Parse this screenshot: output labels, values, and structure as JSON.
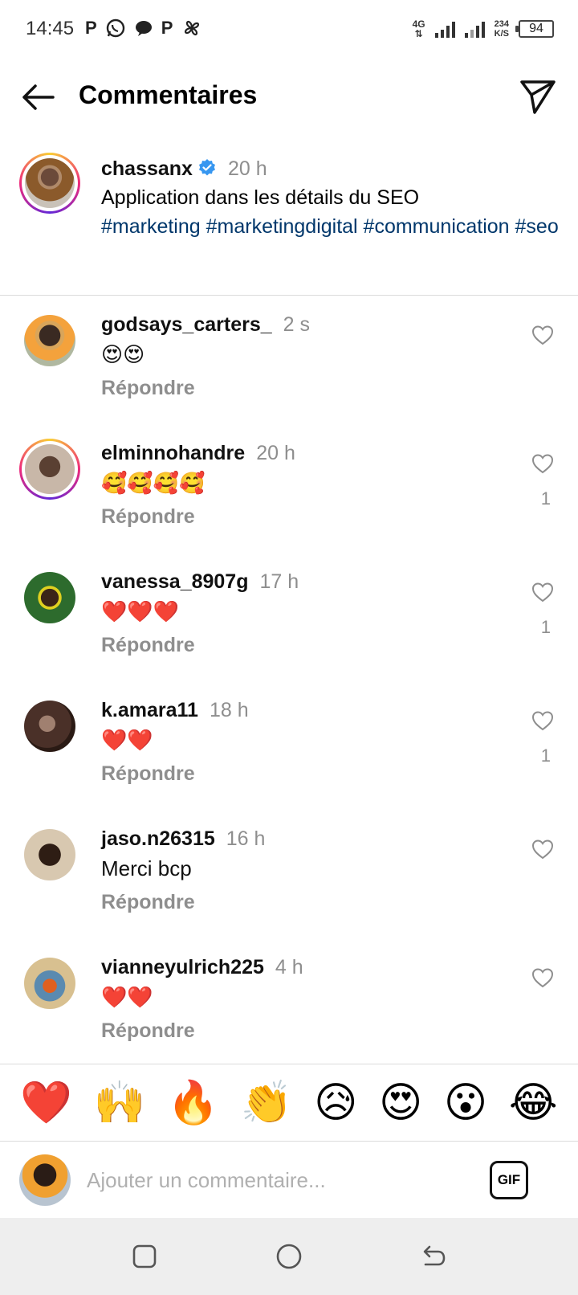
{
  "status_bar": {
    "time": "14:45",
    "app_icons": [
      "P",
      "whatsapp-icon",
      "chat-icon",
      "P",
      "pinwheel-icon"
    ],
    "network": "4G",
    "speed_value": "234",
    "speed_unit": "K/S",
    "battery": "94"
  },
  "header": {
    "title": "Commentaires"
  },
  "caption": {
    "username": "chassanx",
    "verified": true,
    "time": "20 h",
    "text": "Application dans les détails du SEO",
    "hashtags": "#marketing #marketingdigital #communication #seo"
  },
  "comments": [
    {
      "username": "godsays_carters_",
      "time": "2 s",
      "text": "😍😍",
      "reply": "Répondre",
      "likes": ""
    },
    {
      "username": "elminnohandre",
      "time": "20 h",
      "text": "🥰🥰🥰🥰",
      "reply": "Répondre",
      "likes": "1"
    },
    {
      "username": "vanessa_8907g",
      "time": "17 h",
      "text": "❤️❤️❤️",
      "reply": "Répondre",
      "likes": "1"
    },
    {
      "username": "k.amara11",
      "time": "18 h",
      "text": "❤️❤️",
      "reply": "Répondre",
      "likes": "1"
    },
    {
      "username": "jaso.n26315",
      "time": "16 h",
      "text": "Merci bcp",
      "reply": "Répondre",
      "likes": ""
    },
    {
      "username": "vianneyulrich225",
      "time": "4 h",
      "text": "❤️❤️",
      "reply": "Répondre",
      "likes": ""
    }
  ],
  "reactions": [
    "❤️",
    "🙌",
    "🔥",
    "👏",
    "😥",
    "😍",
    "😮",
    "😂"
  ],
  "input": {
    "placeholder": "Ajouter un commentaire...",
    "gif_label": "GIF"
  },
  "colors": {
    "hashtag": "#00376b",
    "secondary_text": "#8e8e8e",
    "verified": "#3897f0"
  }
}
